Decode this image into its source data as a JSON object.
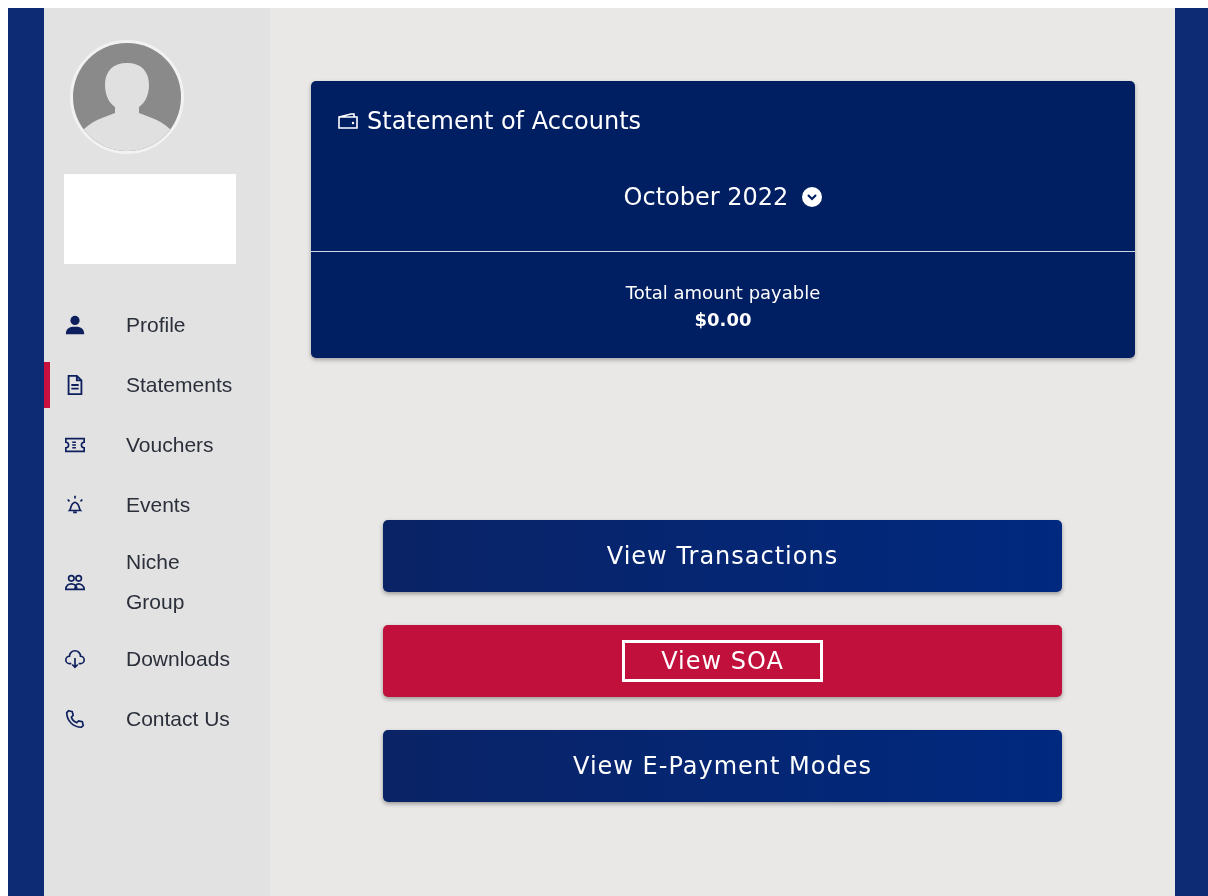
{
  "sidebar": {
    "items": [
      {
        "label": "Profile",
        "selected": false
      },
      {
        "label": "Statements",
        "selected": true
      },
      {
        "label": "Vouchers",
        "selected": false
      },
      {
        "label": "Events",
        "selected": false
      },
      {
        "label": "Niche Group",
        "selected": false
      },
      {
        "label": "Downloads",
        "selected": false
      },
      {
        "label": "Contact Us",
        "selected": false
      }
    ]
  },
  "card": {
    "title": "Statement of Accounts",
    "month": "October 2022",
    "total_label": "Total amount payable",
    "total_value": "$0.00"
  },
  "buttons": [
    {
      "label": "View Transactions",
      "selected": false
    },
    {
      "label": "View SOA",
      "selected": true
    },
    {
      "label": "View E-Payment Modes",
      "selected": false
    }
  ]
}
